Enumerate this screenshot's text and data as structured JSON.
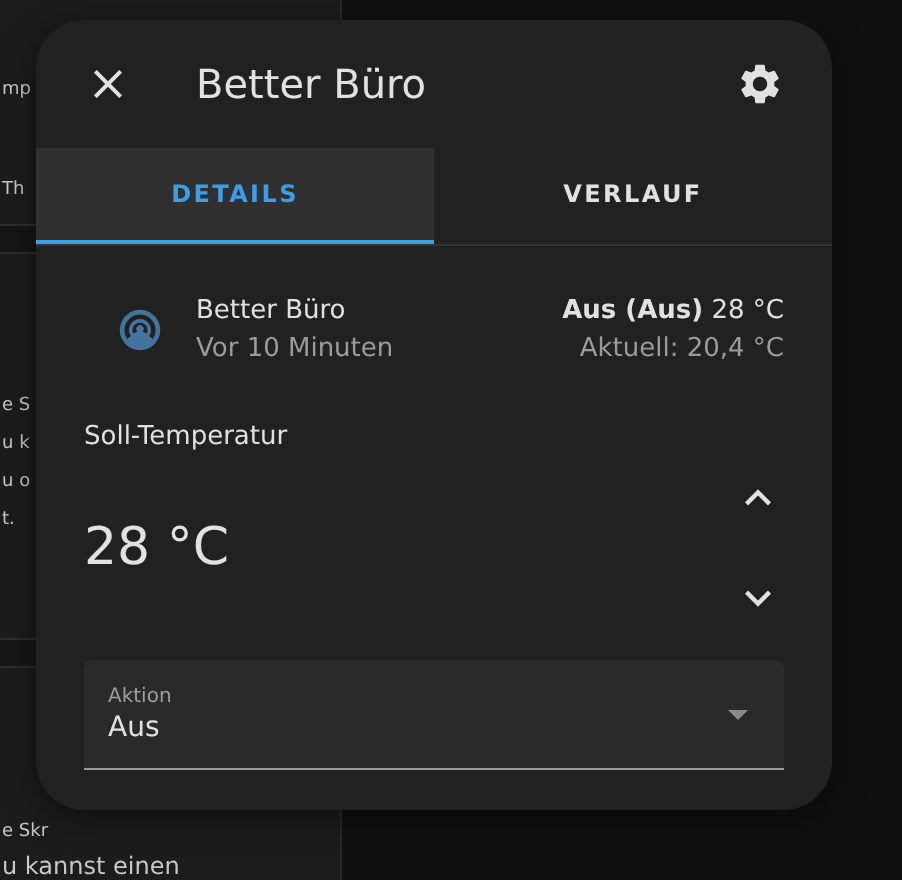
{
  "background": {
    "sections": [
      {
        "texts": [
          "mp",
          "Th"
        ]
      },
      {
        "texts": [
          "e S",
          "u k",
          "u o",
          "t."
        ]
      },
      {
        "texts": [
          "e Skr",
          "u kannst einen"
        ]
      }
    ]
  },
  "dialog": {
    "title": "Better Büro",
    "tabs": [
      {
        "label": "DETAILS",
        "selected": true
      },
      {
        "label": "VERLAUF",
        "selected": false
      }
    ],
    "entity": {
      "name": "Better Büro",
      "last_changed": "Vor 10 Minuten",
      "state": "**Aus (Aus)** 28 °C",
      "current": "Aktuell: 20,4 °C"
    },
    "target": {
      "label": "Soll-Temperatur",
      "value": "28 °C"
    },
    "select": {
      "label": "Aktion",
      "value": "Aus"
    }
  }
}
